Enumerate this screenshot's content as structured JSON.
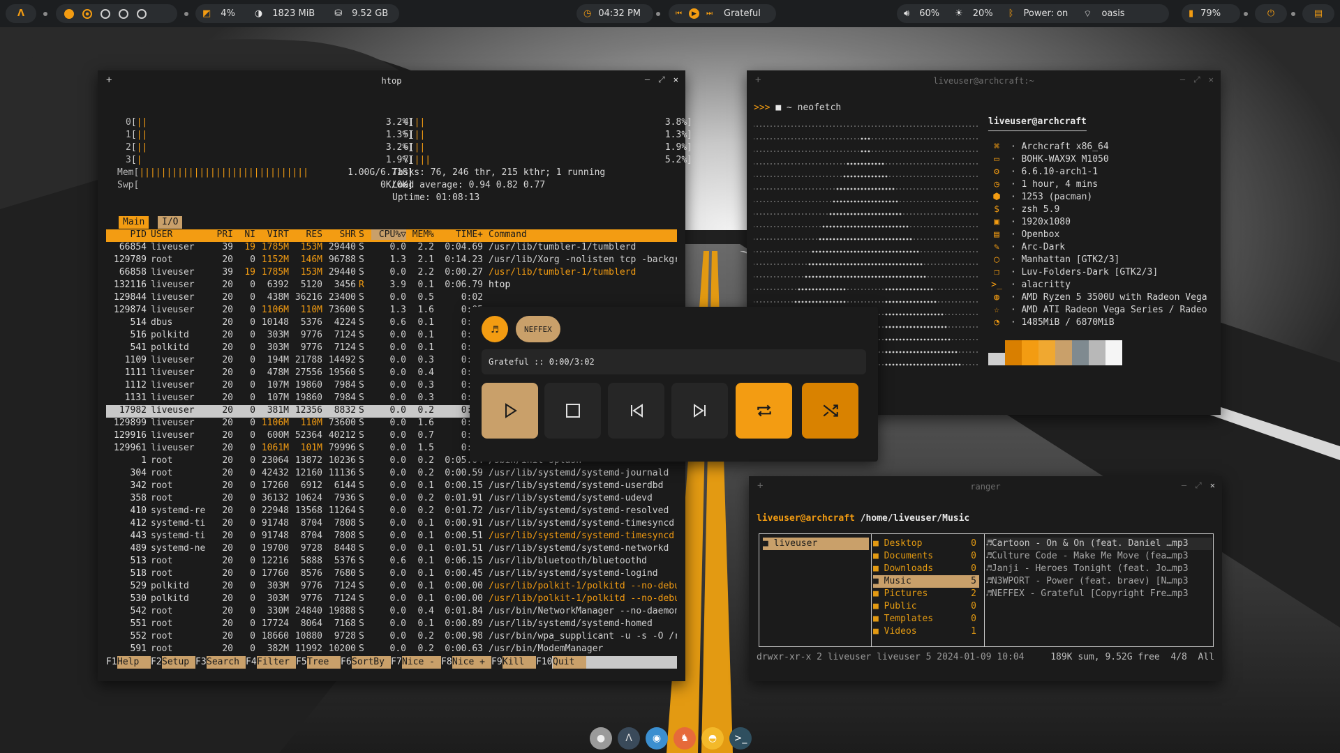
{
  "topbar": {
    "cpu": "4%",
    "mem": "1823 MiB",
    "disk": "9.52 GB",
    "clock": "04:32 PM",
    "song": "Grateful",
    "volume": "60%",
    "brightness": "20%",
    "bluetooth": "Power: on",
    "wifi": "oasis",
    "battery": "79%"
  },
  "htop": {
    "title": "htop",
    "cpus_left": [
      [
        "0",
        "3.2%]"
      ],
      [
        "1",
        "1.3%]"
      ],
      [
        "2",
        "3.2%]"
      ],
      [
        "3",
        "1.9%]"
      ]
    ],
    "cpus_right": [
      [
        "4",
        "3.8%]"
      ],
      [
        "5",
        "1.3%]"
      ],
      [
        "6",
        "1.9%]"
      ],
      [
        "7",
        "5.2%]"
      ]
    ],
    "mem_label": "Mem[",
    "mem_val": "1.00G/6.71G]",
    "swp_label": "Swp[",
    "swp_val": "0K/0K]",
    "tasks": "Tasks: 76, 246 thr, 215 kthr; 1 running",
    "load": "Load average: 0.94 0.82 0.77",
    "uptime": "Uptime: 01:08:13",
    "tab_main": "Main",
    "tab_io": "I/O",
    "header": [
      "PID",
      "USER",
      "PRI",
      "NI",
      "VIRT",
      "RES",
      "SHR",
      "S",
      "CPU%▽",
      "MEM%",
      "TIME+",
      "Command"
    ],
    "rows": [
      [
        "66854",
        "liveuser",
        "39",
        "19",
        "1785M",
        "153M",
        "29440",
        "S",
        "0.0",
        "2.2",
        "0:04.69",
        "/usr/lib/tumbler-1/tumblerd"
      ],
      [
        "129789",
        "root",
        "20",
        "0",
        "1152M",
        "146M",
        "96788",
        "S",
        "1.3",
        "2.1",
        "0:14.23",
        "/usr/lib/Xorg -nolisten tcp -backgr"
      ],
      [
        "66858",
        "liveuser",
        "39",
        "19",
        "1785M",
        "153M",
        "29440",
        "S",
        "0.0",
        "2.2",
        "0:00.27",
        "/usr/lib/tumbler-1/tumblerd"
      ],
      [
        "132116",
        "liveuser",
        "20",
        "0",
        "6392",
        "5120",
        "3456",
        "R",
        "3.9",
        "0.1",
        "0:06.79",
        "htop"
      ],
      [
        "129844",
        "liveuser",
        "20",
        "0",
        "438M",
        "36216",
        "23400",
        "S",
        "0.0",
        "0.5",
        "0:02",
        ""
      ],
      [
        "129874",
        "liveuser",
        "20",
        "0",
        "1106M",
        "110M",
        "73600",
        "S",
        "1.3",
        "1.6",
        "0:05",
        ""
      ],
      [
        "514",
        "dbus",
        "20",
        "0",
        "10148",
        "5376",
        "4224",
        "S",
        "0.6",
        "0.1",
        "0:57",
        ""
      ],
      [
        "516",
        "polkitd",
        "20",
        "0",
        "303M",
        "9776",
        "7124",
        "S",
        "0.0",
        "0.1",
        "0:11",
        ""
      ],
      [
        "541",
        "polkitd",
        "20",
        "0",
        "303M",
        "9776",
        "7124",
        "S",
        "0.0",
        "0.1",
        "0:05",
        ""
      ],
      [
        "1109",
        "liveuser",
        "20",
        "0",
        "194M",
        "21788",
        "14492",
        "S",
        "0.0",
        "0.3",
        "0:05",
        ""
      ],
      [
        "1111",
        "liveuser",
        "20",
        "0",
        "478M",
        "27556",
        "19560",
        "S",
        "0.0",
        "0.4",
        "0:05",
        ""
      ],
      [
        "1112",
        "liveuser",
        "20",
        "0",
        "107M",
        "19860",
        "7984",
        "S",
        "0.0",
        "0.3",
        "0:01",
        ""
      ],
      [
        "1131",
        "liveuser",
        "20",
        "0",
        "107M",
        "19860",
        "7984",
        "S",
        "0.0",
        "0.3",
        "0:00",
        ""
      ],
      [
        "17982",
        "liveuser",
        "20",
        "0",
        "381M",
        "12356",
        "8832",
        "S",
        "0.0",
        "0.2",
        "0:02",
        ""
      ],
      [
        "129899",
        "liveuser",
        "20",
        "0",
        "1106M",
        "110M",
        "73600",
        "S",
        "0.0",
        "1.6",
        "0:00",
        ""
      ],
      [
        "129916",
        "liveuser",
        "20",
        "0",
        "600M",
        "52364",
        "40212",
        "S",
        "0.0",
        "0.7",
        "0:04",
        ""
      ],
      [
        "129961",
        "liveuser",
        "20",
        "0",
        "1061M",
        "101M",
        "79996",
        "S",
        "0.0",
        "1.5",
        "0:00",
        ""
      ],
      [
        "1",
        "root",
        "20",
        "0",
        "23064",
        "13872",
        "10236",
        "S",
        "0.0",
        "0.2",
        "0:05.04",
        "/sbin/init splash"
      ],
      [
        "304",
        "root",
        "20",
        "0",
        "42432",
        "12160",
        "11136",
        "S",
        "0.0",
        "0.2",
        "0:00.59",
        "/usr/lib/systemd/systemd-journald"
      ],
      [
        "342",
        "root",
        "20",
        "0",
        "17260",
        "6912",
        "6144",
        "S",
        "0.0",
        "0.1",
        "0:00.15",
        "/usr/lib/systemd/systemd-userdbd"
      ],
      [
        "358",
        "root",
        "20",
        "0",
        "36132",
        "10624",
        "7936",
        "S",
        "0.0",
        "0.2",
        "0:01.91",
        "/usr/lib/systemd/systemd-udevd"
      ],
      [
        "410",
        "systemd-re",
        "20",
        "0",
        "22948",
        "13568",
        "11264",
        "S",
        "0.0",
        "0.2",
        "0:01.72",
        "/usr/lib/systemd/systemd-resolved"
      ],
      [
        "412",
        "systemd-ti",
        "20",
        "0",
        "91748",
        "8704",
        "7808",
        "S",
        "0.0",
        "0.1",
        "0:00.91",
        "/usr/lib/systemd/systemd-timesyncd"
      ],
      [
        "443",
        "systemd-ti",
        "20",
        "0",
        "91748",
        "8704",
        "7808",
        "S",
        "0.0",
        "0.1",
        "0:00.51",
        "/usr/lib/systemd/systemd-timesyncd"
      ],
      [
        "489",
        "systemd-ne",
        "20",
        "0",
        "19700",
        "9728",
        "8448",
        "S",
        "0.0",
        "0.1",
        "0:01.51",
        "/usr/lib/systemd/systemd-networkd"
      ],
      [
        "513",
        "root",
        "20",
        "0",
        "12216",
        "5888",
        "5376",
        "S",
        "0.6",
        "0.1",
        "0:06.15",
        "/usr/lib/bluetooth/bluetoothd"
      ],
      [
        "518",
        "root",
        "20",
        "0",
        "17760",
        "8576",
        "7680",
        "S",
        "0.0",
        "0.1",
        "0:00.45",
        "/usr/lib/systemd/systemd-logind"
      ],
      [
        "529",
        "polkitd",
        "20",
        "0",
        "303M",
        "9776",
        "7124",
        "S",
        "0.0",
        "0.1",
        "0:00.00",
        "/usr/lib/polkit-1/polkitd --no-debu"
      ],
      [
        "530",
        "polkitd",
        "20",
        "0",
        "303M",
        "9776",
        "7124",
        "S",
        "0.0",
        "0.1",
        "0:00.00",
        "/usr/lib/polkit-1/polkitd --no-debu"
      ],
      [
        "542",
        "root",
        "20",
        "0",
        "330M",
        "24840",
        "19888",
        "S",
        "0.0",
        "0.4",
        "0:01.84",
        "/usr/bin/NetworkManager --no-daemon"
      ],
      [
        "551",
        "root",
        "20",
        "0",
        "17724",
        "8064",
        "7168",
        "S",
        "0.0",
        "0.1",
        "0:00.89",
        "/usr/lib/systemd/systemd-homed"
      ],
      [
        "552",
        "root",
        "20",
        "0",
        "18660",
        "10880",
        "9728",
        "S",
        "0.0",
        "0.2",
        "0:00.98",
        "/usr/bin/wpa_supplicant -u -s -O /r"
      ],
      [
        "591",
        "root",
        "20",
        "0",
        "382M",
        "11992",
        "10200",
        "S",
        "0.0",
        "0.2",
        "0:00.63",
        "/usr/bin/ModemManager"
      ]
    ],
    "fkeys": [
      [
        "F1",
        "Help"
      ],
      [
        "F2",
        "Setup"
      ],
      [
        "F3",
        "Search"
      ],
      [
        "F4",
        "Filter"
      ],
      [
        "F5",
        "Tree"
      ],
      [
        "F6",
        "SortBy"
      ],
      [
        "F7",
        "Nice -"
      ],
      [
        "F8",
        "Nice +"
      ],
      [
        "F9",
        "Kill"
      ],
      [
        "F10",
        "Quit"
      ]
    ]
  },
  "neofetch": {
    "title": "liveuser@archcraft:~",
    "prompt": ">>> ",
    "cwd": "~",
    "command": "neofetch",
    "user_host": "liveuser@archcraft",
    "separator": "──────────────────",
    "info": [
      [
        "⌘",
        "Archcraft x86_64"
      ],
      [
        "▭",
        "BOHK-WAX9X M1050"
      ],
      [
        "⚙",
        "6.6.10-arch1-1"
      ],
      [
        "◷",
        "1 hour, 4 mins"
      ],
      [
        "⬢",
        "1253 (pacman)"
      ],
      [
        "$",
        "zsh 5.9"
      ],
      [
        "▣",
        "1920x1080"
      ],
      [
        "▤",
        "Openbox"
      ],
      [
        "✎",
        "Arc-Dark"
      ],
      [
        "◯",
        "Manhattan [GTK2/3]"
      ],
      [
        "❐",
        "Luv-Folders-Dark [GTK2/3]"
      ],
      [
        ">_",
        "alacritty"
      ],
      [
        "◍",
        "AMD Ryzen 5 3500U with Radeon Vega"
      ],
      [
        "☆",
        "AMD ATI Radeon Vega Series / Radeo"
      ],
      [
        "◔",
        "1485MiB / 6870MiB"
      ]
    ],
    "swatches": [
      "#cfcfcf",
      "#d97f00",
      "#f39c12",
      "#f0a830",
      "#c9a06a",
      "#7f8a90",
      "#b8b8b8",
      "#f5f5f5"
    ]
  },
  "player": {
    "artist": "NEFFEX",
    "status": "Grateful :: 0:00/3:02"
  },
  "ranger": {
    "title": "ranger",
    "user": "liveuser@archcraft",
    "path": "/home/liveuser/Music",
    "col1": "liveuser",
    "dirs": [
      [
        "Desktop",
        "0"
      ],
      [
        "Documents",
        "0"
      ],
      [
        "Downloads",
        "0"
      ],
      [
        "Music",
        "5"
      ],
      [
        "Pictures",
        "2"
      ],
      [
        "Public",
        "0"
      ],
      [
        "Templates",
        "0"
      ],
      [
        "Videos",
        "1"
      ]
    ],
    "files": [
      "Cartoon - On & On (feat. Daniel …mp3",
      "Culture Code - Make Me Move (fea…mp3",
      "Janji - Heroes Tonight (feat. Jo…mp3",
      "N3WPORT - Power (feat. braev) [N…mp3",
      "NEFFEX - Grateful [Copyright Fre…mp3"
    ],
    "status_left": "drwxr-xr-x 2 liveuser liveuser 5 2024-01-09 10:04",
    "status_right": "189K sum, 9.52G free  4/8  All"
  },
  "dock": [
    "settings-icon",
    "archcraft-icon",
    "browser-icon",
    "firefox-icon",
    "files-icon",
    "terminal-icon"
  ]
}
